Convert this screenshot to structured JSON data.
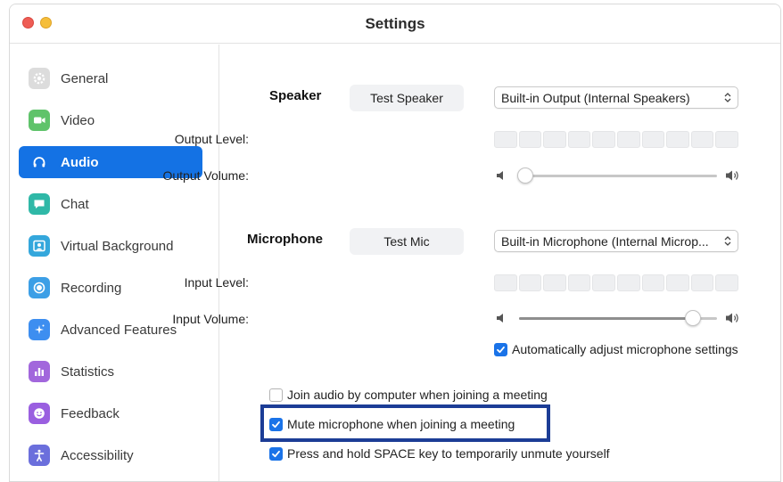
{
  "window": {
    "title": "Settings"
  },
  "sidebar": {
    "items": [
      {
        "label": "General",
        "icon": "gear-icon",
        "icon_color": "#b8b8b8"
      },
      {
        "label": "Video",
        "icon": "video-camera-icon",
        "icon_color": "#5fc36a"
      },
      {
        "label": "Audio",
        "icon": "headphones-icon",
        "icon_color": "#ffffff",
        "active": true
      },
      {
        "label": "Chat",
        "icon": "chat-bubble-icon",
        "icon_color": "#2fb8a7"
      },
      {
        "label": "Virtual Background",
        "icon": "person-frame-icon",
        "icon_color": "#34a7dc"
      },
      {
        "label": "Recording",
        "icon": "record-icon",
        "icon_color": "#3c9fe6"
      },
      {
        "label": "Advanced Features",
        "icon": "sparkle-icon",
        "icon_color": "#3d8ef0"
      },
      {
        "label": "Statistics",
        "icon": "bar-chart-icon",
        "icon_color": "#a267dc"
      },
      {
        "label": "Feedback",
        "icon": "smiley-icon",
        "icon_color": "#9a5fe0"
      },
      {
        "label": "Accessibility",
        "icon": "accessibility-icon",
        "icon_color": "#6b6fdc"
      }
    ]
  },
  "speaker": {
    "section_label": "Speaker",
    "test_button": "Test Speaker",
    "device_selected": "Built-in Output (Internal Speakers)",
    "output_level_label": "Output Level:",
    "output_volume_label": "Output Volume:",
    "output_volume_fraction": 0.03
  },
  "microphone": {
    "section_label": "Microphone",
    "test_button": "Test Mic",
    "device_selected": "Built-in Microphone (Internal Microp...",
    "input_level_label": "Input Level:",
    "input_volume_label": "Input Volume:",
    "input_volume_fraction": 0.88,
    "auto_adjust_label": "Automatically adjust microphone settings",
    "auto_adjust_checked": true
  },
  "options": [
    {
      "label": "Join audio by computer when joining a meeting",
      "checked": false
    },
    {
      "label": "Mute microphone when joining a meeting",
      "checked": true,
      "highlighted": true
    },
    {
      "label": "Press and hold SPACE key to temporarily unmute yourself",
      "checked": true
    }
  ],
  "colors": {
    "accent": "#1472e4",
    "checkbox_checked": "#1a73e8",
    "highlight_border": "#1c3d96"
  }
}
